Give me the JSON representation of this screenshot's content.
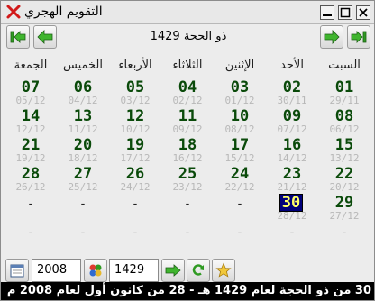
{
  "window": {
    "title": "التقويم الهجري"
  },
  "header": {
    "month_title": "ذو الحجة 1429"
  },
  "day_names": [
    "السبت",
    "الأحد",
    "الإثنين",
    "الثلاثاء",
    "الأربعاء",
    "الخميس",
    "الجمعة"
  ],
  "weeks": [
    [
      {
        "h": "01",
        "g": "29/11"
      },
      {
        "h": "02",
        "g": "30/11"
      },
      {
        "h": "03",
        "g": "01/12"
      },
      {
        "h": "04",
        "g": "02/12"
      },
      {
        "h": "05",
        "g": "03/12"
      },
      {
        "h": "06",
        "g": "04/12"
      },
      {
        "h": "07",
        "g": "05/12"
      }
    ],
    [
      {
        "h": "08",
        "g": "06/12"
      },
      {
        "h": "09",
        "g": "07/12"
      },
      {
        "h": "10",
        "g": "08/12"
      },
      {
        "h": "11",
        "g": "09/12"
      },
      {
        "h": "12",
        "g": "10/12"
      },
      {
        "h": "13",
        "g": "11/12"
      },
      {
        "h": "14",
        "g": "12/12"
      }
    ],
    [
      {
        "h": "15",
        "g": "13/12"
      },
      {
        "h": "16",
        "g": "14/12"
      },
      {
        "h": "17",
        "g": "15/12"
      },
      {
        "h": "18",
        "g": "16/12"
      },
      {
        "h": "19",
        "g": "17/12"
      },
      {
        "h": "20",
        "g": "18/12"
      },
      {
        "h": "21",
        "g": "19/12"
      }
    ],
    [
      {
        "h": "22",
        "g": "20/12"
      },
      {
        "h": "23",
        "g": "21/12"
      },
      {
        "h": "24",
        "g": "22/12"
      },
      {
        "h": "25",
        "g": "23/12"
      },
      {
        "h": "26",
        "g": "24/12"
      },
      {
        "h": "27",
        "g": "25/12"
      },
      {
        "h": "28",
        "g": "26/12"
      }
    ],
    [
      {
        "h": "29",
        "g": "27/12"
      },
      {
        "h": "30",
        "g": "28/12",
        "today": true
      },
      {
        "empty": "-"
      },
      {
        "empty": "-"
      },
      {
        "empty": "-"
      },
      {
        "empty": "-"
      },
      {
        "empty": "-"
      }
    ],
    [
      {
        "empty": "-"
      },
      {
        "empty": "-"
      },
      {
        "empty": "-"
      },
      {
        "empty": "-"
      },
      {
        "empty": "-"
      },
      {
        "empty": "-"
      },
      {
        "empty": "-"
      }
    ]
  ],
  "controls": {
    "gregorian_year": "2008",
    "hijri_year": "1429"
  },
  "status": {
    "text": "30 من ذو الحجة لعام 1429 هـ - 28 من كانون أول لعام 2008 م"
  },
  "colors": {
    "hijri_number": "#0a4a0a",
    "gregorian_date": "#b8b8b8",
    "today_bg": "#00007a",
    "today_fg": "#ffff66",
    "nav_arrow": "#2f9a22"
  },
  "icons": [
    "close-icon",
    "minimize-icon",
    "maximize-icon",
    "window-close-icon",
    "last-month-icon",
    "next-month-icon",
    "previous-month-icon",
    "first-month-icon",
    "calendar-icon",
    "convert-icon",
    "arrow-right-icon",
    "refresh-icon",
    "star-icon"
  ]
}
